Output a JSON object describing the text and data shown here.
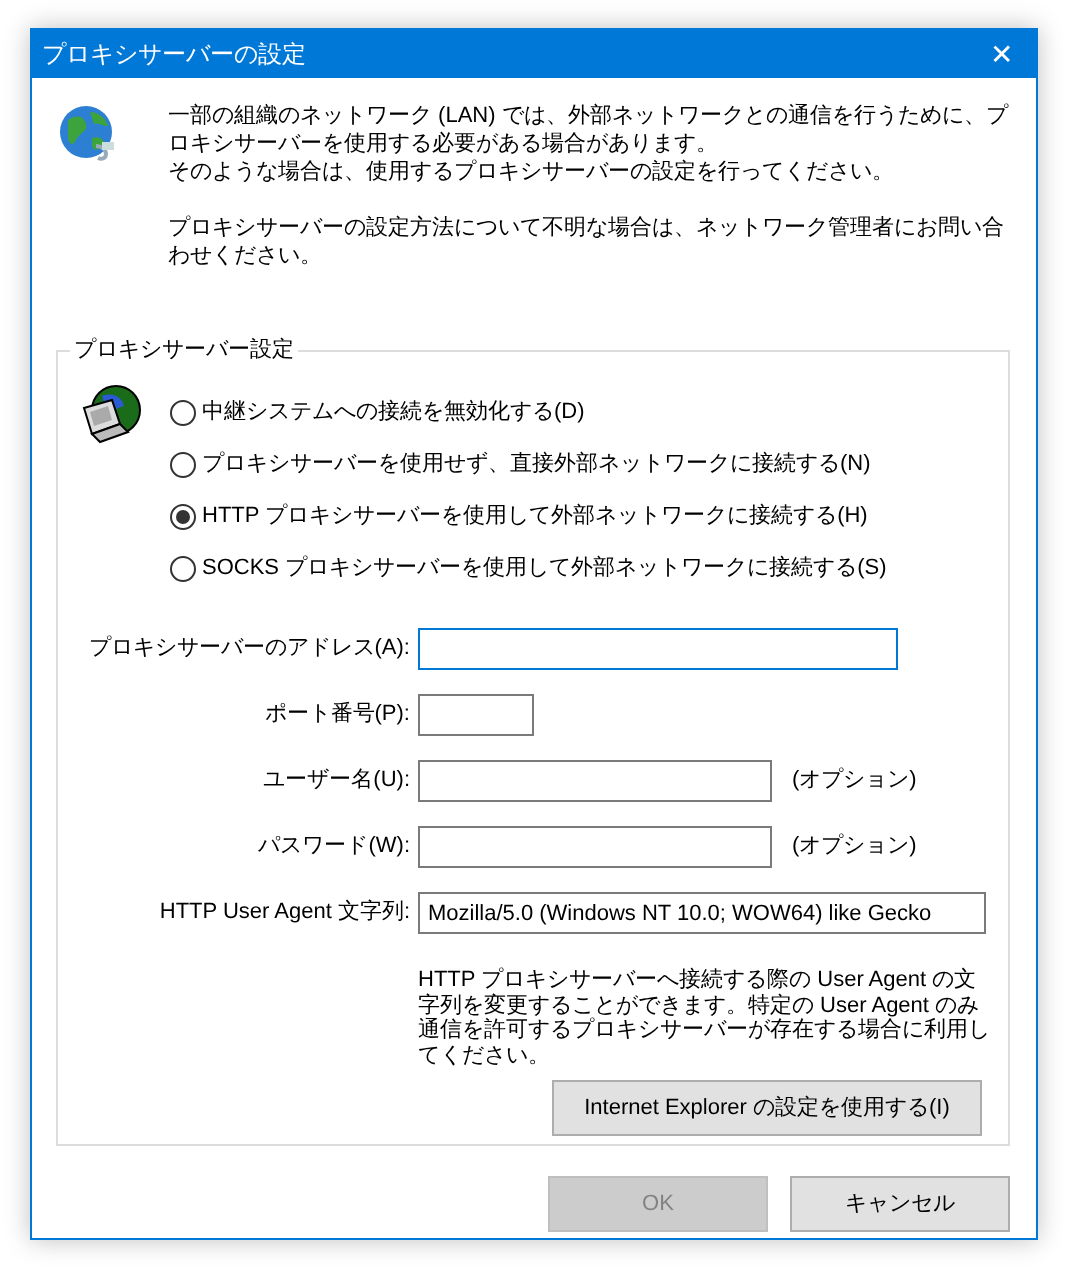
{
  "window": {
    "title": "プロキシサーバーの設定",
    "close": "✕"
  },
  "intro": [
    [
      "一部の組織のネットワーク (LAN) では、外部ネットワークとの通信を行うために、プロキシサーバーを使用する必要がある場合があります。",
      "そのような場合は、使用するプロキシサーバーの設定を行ってください。"
    ],
    [
      "プロキシサーバーの設定方法について不明な場合は、ネットワーク管理者にお問い合わせください。"
    ]
  ],
  "group": {
    "title": "プロキシサーバー設定",
    "options": [
      {
        "label": "中継システムへの接続を無効化する(D)",
        "selected": false
      },
      {
        "label": "プロキシサーバーを使用せず、直接外部ネットワークに接続する(N)",
        "selected": false
      },
      {
        "label": "HTTP プロキシサーバーを使用して外部ネットワークに接続する(H)",
        "selected": true
      },
      {
        "label": "SOCKS プロキシサーバーを使用して外部ネットワークに接続する(S)",
        "selected": false
      }
    ],
    "fields": [
      {
        "label": "プロキシサーバーのアドレス(A):",
        "focused": true
      },
      {
        "label": "ポート番号(P):",
        "focused": false
      },
      {
        "label": "ユーザー名(U):",
        "focused": false,
        "note": "(オプション)"
      },
      {
        "label": "パスワード(W):",
        "focused": false,
        "note": "(オプション)"
      },
      {
        "label": "HTTP User Agent 文字列:",
        "focused": false,
        "value": "Mozilla/5.0 (Windows NT 10.0; WOW64) like Gecko"
      }
    ],
    "help": "HTTP プロキシサーバーへ接続する際の User Agent の文字列を変更することができます。特定の User Agent のみ通信を許可するプロキシサーバーが存在する場合に利用してください。",
    "ie_button": "Internet Explorer の設定を使用する(I)"
  },
  "buttons": [
    {
      "label": "OK",
      "disabled": true
    },
    {
      "label": "キャンセル",
      "disabled": false
    }
  ]
}
